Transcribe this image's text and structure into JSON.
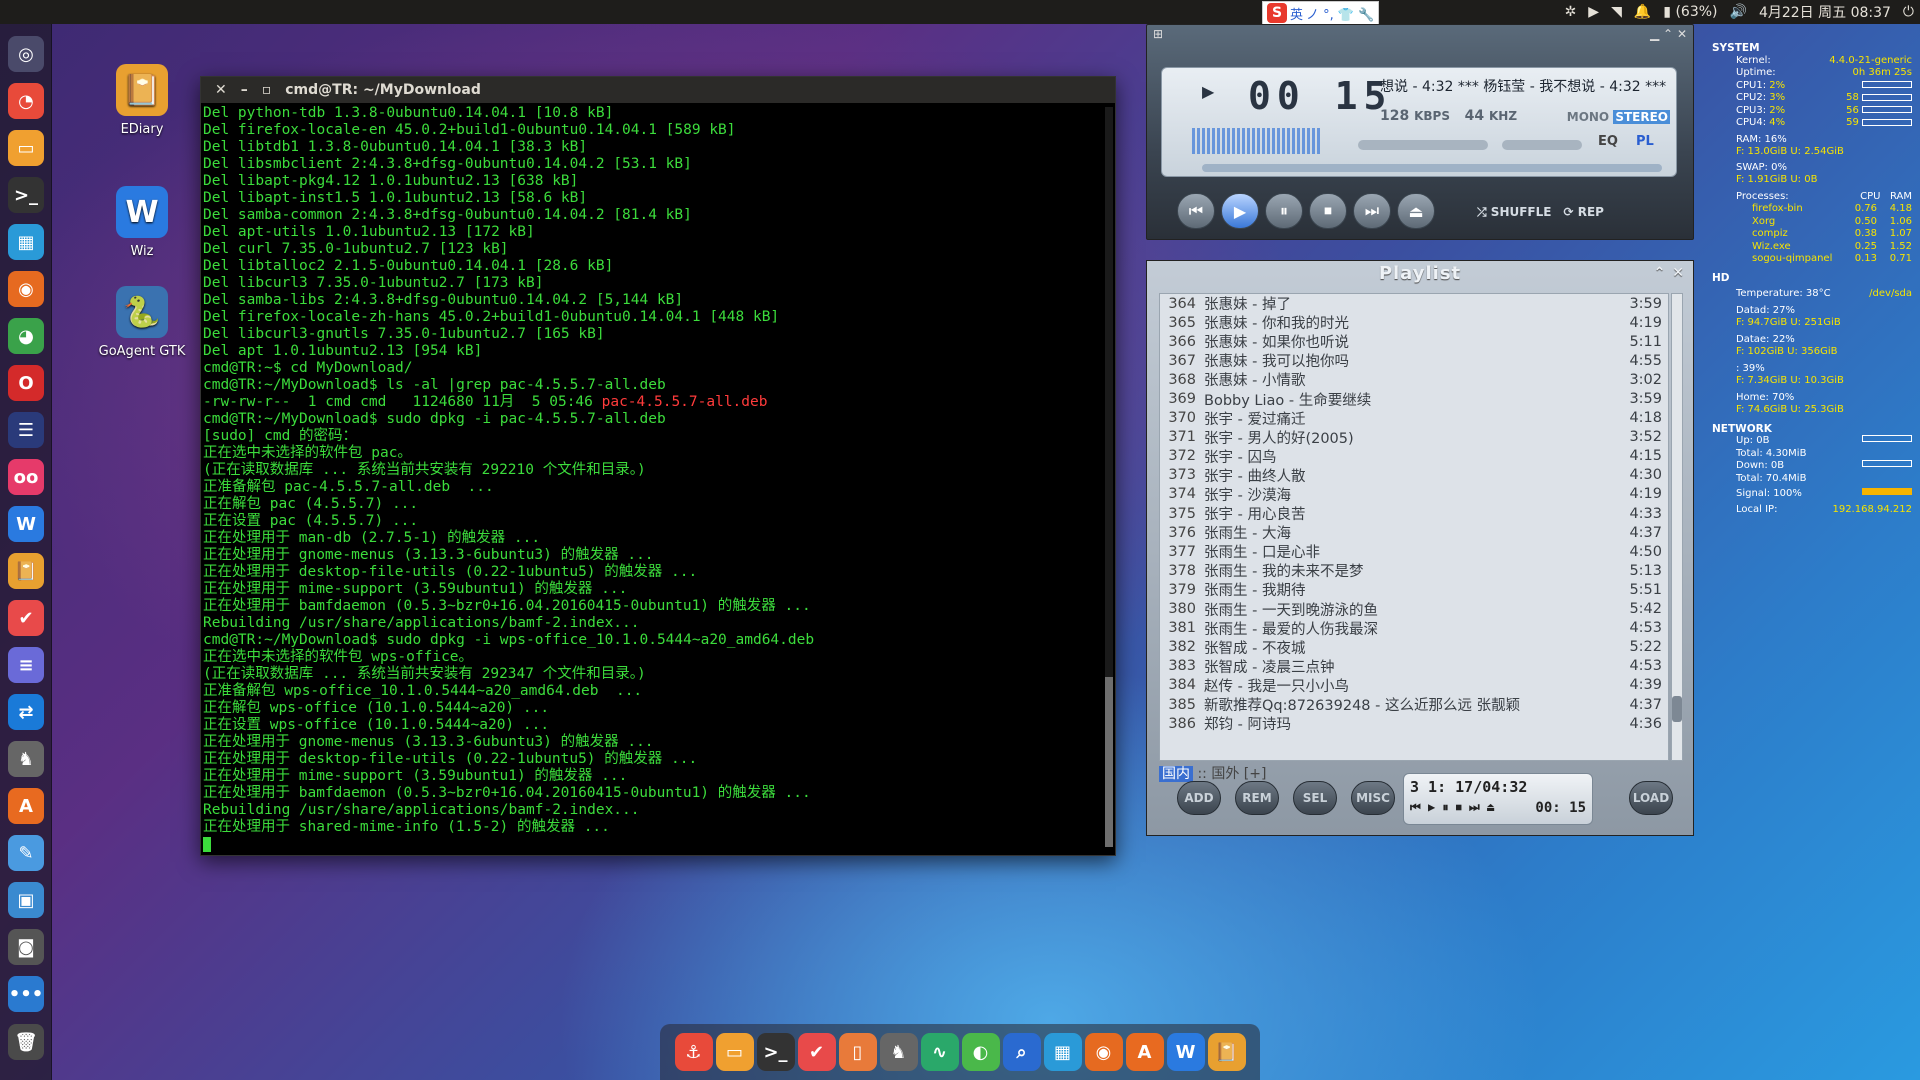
{
  "topbar": {
    "ime_logo": "S",
    "ime_label": "英",
    "ime_extras": "ノ °, 👕 🔧",
    "battery": "(63%)",
    "datetime": "4月22日 周五 08:37"
  },
  "desktop_icons": [
    {
      "label": "EDiary",
      "icon": "book-icon",
      "color": "#e8a030",
      "glyph": "📔"
    },
    {
      "label": "Wiz",
      "icon": "wiz-icon",
      "color": "#2a7ae0",
      "glyph": "W"
    },
    {
      "label": "GoAgent GTK",
      "icon": "python-icon",
      "color": "#3a72b0",
      "glyph": "🐍"
    }
  ],
  "launcher": [
    {
      "name": "ubuntu-icon",
      "color": "#4a4a6a",
      "glyph": "◎"
    },
    {
      "name": "chart-icon",
      "color": "#e84a3a",
      "glyph": "◔"
    },
    {
      "name": "files-icon",
      "color": "#f0a030",
      "glyph": "▭"
    },
    {
      "name": "terminal-icon",
      "color": "#333",
      "glyph": ">_"
    },
    {
      "name": "monitor-icon",
      "color": "#2a9ad8",
      "glyph": "▦"
    },
    {
      "name": "firefox-icon",
      "color": "#e66a20",
      "glyph": "◉"
    },
    {
      "name": "chrome-icon",
      "color": "#3aa24a",
      "glyph": "◕"
    },
    {
      "name": "opera-icon",
      "color": "#d42a2a",
      "glyph": "O"
    },
    {
      "name": "eclipse-icon",
      "color": "#2a3a7a",
      "glyph": "☰"
    },
    {
      "name": "flickr-icon",
      "color": "#e63a6a",
      "glyph": "oo"
    },
    {
      "name": "wiz-icon",
      "color": "#2a7ae0",
      "glyph": "W"
    },
    {
      "name": "ediary-icon",
      "color": "#e8a030",
      "glyph": "📔"
    },
    {
      "name": "todo-icon",
      "color": "#e84a4a",
      "glyph": "✔"
    },
    {
      "name": "document-icon",
      "color": "#6a6ad8",
      "glyph": "≡"
    },
    {
      "name": "teamviewer-icon",
      "color": "#1a7ad8",
      "glyph": "⇄"
    },
    {
      "name": "bird-icon",
      "color": "#666",
      "glyph": "♞"
    },
    {
      "name": "software-center-icon",
      "color": "#e86a20",
      "glyph": "A"
    },
    {
      "name": "notes-icon",
      "color": "#4a9ae0",
      "glyph": "✎"
    },
    {
      "name": "package-icon",
      "color": "#3a8ad0",
      "glyph": "▣"
    },
    {
      "name": "camera-icon",
      "color": "#555",
      "glyph": "◙"
    },
    {
      "name": "more-icon",
      "color": "#2a7ad0",
      "glyph": "•••"
    },
    {
      "name": "trash-icon",
      "color": "#4a4a4a",
      "glyph": "🗑"
    }
  ],
  "terminal": {
    "title": "cmd@TR: ~/MyDownload",
    "lines": [
      "Del python-tdb 1.3.8-0ubuntu0.14.04.1 [10.8 kB]",
      "Del firefox-locale-en 45.0.2+build1-0ubuntu0.14.04.1 [589 kB]",
      "Del libtdb1 1.3.8-0ubuntu0.14.04.1 [38.3 kB]",
      "Del libsmbclient 2:4.3.8+dfsg-0ubuntu0.14.04.2 [53.1 kB]",
      "Del libapt-pkg4.12 1.0.1ubuntu2.13 [638 kB]",
      "Del libapt-inst1.5 1.0.1ubuntu2.13 [58.6 kB]",
      "Del samba-common 2:4.3.8+dfsg-0ubuntu0.14.04.2 [81.4 kB]",
      "Del apt-utils 1.0.1ubuntu2.13 [172 kB]",
      "Del curl 7.35.0-1ubuntu2.7 [123 kB]",
      "Del libtalloc2 2.1.5-0ubuntu0.14.04.1 [28.6 kB]",
      "Del libcurl3 7.35.0-1ubuntu2.7 [173 kB]",
      "Del samba-libs 2:4.3.8+dfsg-0ubuntu0.14.04.2 [5,144 kB]",
      "Del firefox-locale-zh-hans 45.0.2+build1-0ubuntu0.14.04.1 [448 kB]",
      "Del libcurl3-gnutls 7.35.0-1ubuntu2.7 [165 kB]",
      "Del apt 1.0.1ubuntu2.13 [954 kB]",
      "cmd@TR:~$ cd MyDownload/",
      "cmd@TR:~/MyDownload$ ls -al |grep pac-4.5.5.7-all.deb",
      "-rw-rw-r--  1 cmd cmd   1124680 11月  5 05:46 ",
      "cmd@TR:~/MyDownload$ sudo dpkg -i pac-4.5.5.7-all.deb",
      "[sudo] cmd 的密码：",
      "正在选中未选择的软件包 pac。",
      "(正在读取数据库 ... 系统当前共安装有 292210 个文件和目录。)",
      "正准备解包 pac-4.5.5.7-all.deb  ...",
      "正在解包 pac (4.5.5.7) ...",
      "正在设置 pac (4.5.5.7) ...",
      "正在处理用于 man-db (2.7.5-1) 的触发器 ...",
      "正在处理用于 gnome-menus (3.13.3-6ubuntu3) 的触发器 ...",
      "正在处理用于 desktop-file-utils (0.22-1ubuntu5) 的触发器 ...",
      "正在处理用于 mime-support (3.59ubuntu1) 的触发器 ...",
      "正在处理用于 bamfdaemon (0.5.3~bzr0+16.04.20160415-0ubuntu1) 的触发器 ...",
      "Rebuilding /usr/share/applications/bamf-2.index...",
      "cmd@TR:~/MyDownload$ sudo dpkg -i wps-office_10.1.0.5444~a20_amd64.deb",
      "正在选中未选择的软件包 wps-office。",
      "(正在读取数据库 ... 系统当前共安装有 292347 个文件和目录。)",
      "正准备解包 wps-office_10.1.0.5444~a20_amd64.deb  ...",
      "正在解包 wps-office (10.1.0.5444~a20) ...",
      "正在设置 wps-office (10.1.0.5444~a20) ...",
      "正在处理用于 gnome-menus (3.13.3-6ubuntu3) 的触发器 ...",
      "正在处理用于 desktop-file-utils (0.22-1ubuntu5) 的触发器 ...",
      "正在处理用于 mime-support (3.59ubuntu1) 的触发器 ...",
      "正在处理用于 bamfdaemon (0.5.3~bzr0+16.04.20160415-0ubuntu1) 的触发器 ...",
      "Rebuilding /usr/share/applications/bamf-2.index...",
      "正在处理用于 shared-mime-info (1.5-2) 的触发器 ..."
    ],
    "highlight_line": 17,
    "highlight_text": "pac-4.5.5.7-all.deb"
  },
  "player": {
    "time": "00 15",
    "title": "想说 - 4:32  *** 杨钰莹 - 我不想说 - 4:32  ***",
    "kbps": "128",
    "kbps_unit": "KBPS",
    "khz": "44",
    "khz_unit": "KHZ",
    "mono": "MONO",
    "stereo": "STEREO",
    "eq": "EQ",
    "pl": "PL",
    "shuffle": "SHUFFLE",
    "rep": "REP"
  },
  "playlist": {
    "title": "Playlist",
    "items": [
      {
        "n": "364",
        "t": "张惠妹 - 掉了",
        "d": "3:59"
      },
      {
        "n": "365",
        "t": "张惠妹 - 你和我的时光",
        "d": "4:19"
      },
      {
        "n": "366",
        "t": "张惠妹 - 如果你也听说",
        "d": "5:11"
      },
      {
        "n": "367",
        "t": "张惠妹 - 我可以抱你吗",
        "d": "4:55"
      },
      {
        "n": "368",
        "t": "张惠妹 - 小情歌",
        "d": "3:02"
      },
      {
        "n": "369",
        "t": "Bobby Liao - 生命要继续",
        "d": "3:59"
      },
      {
        "n": "370",
        "t": "张宇 - 爱过痛迁",
        "d": "4:18"
      },
      {
        "n": "371",
        "t": "张宇 - 男人的好(2005)",
        "d": "3:52"
      },
      {
        "n": "372",
        "t": "张宇 - 囚鸟",
        "d": "4:15"
      },
      {
        "n": "373",
        "t": "张宇 - 曲终人散",
        "d": "4:30"
      },
      {
        "n": "374",
        "t": "张宇 - 沙漠海",
        "d": "4:19"
      },
      {
        "n": "375",
        "t": "张宇 - 用心良苦",
        "d": "4:33"
      },
      {
        "n": "376",
        "t": "张雨生 - 大海",
        "d": "4:37"
      },
      {
        "n": "377",
        "t": "张雨生 - 口是心非",
        "d": "4:50"
      },
      {
        "n": "378",
        "t": "张雨生 - 我的未来不是梦",
        "d": "5:13"
      },
      {
        "n": "379",
        "t": "张雨生 - 我期待",
        "d": "5:51"
      },
      {
        "n": "380",
        "t": "张雨生 - 一天到晚游泳的鱼",
        "d": "5:42"
      },
      {
        "n": "381",
        "t": "张雨生 - 最爱的人伤我最深",
        "d": "4:53"
      },
      {
        "n": "382",
        "t": "张智成 - 不夜城",
        "d": "5:22"
      },
      {
        "n": "383",
        "t": "张智成 - 凌晨三点钟",
        "d": "4:53"
      },
      {
        "n": "384",
        "t": "赵传 - 我是一只小小鸟",
        "d": "4:39"
      },
      {
        "n": "385",
        "t": "新歌推荐Qq:872639248 - 这么近那么远 张靓颖",
        "d": "4:37"
      },
      {
        "n": "386",
        "t": "郑钧 - 阿诗玛",
        "d": "4:36"
      }
    ],
    "tab_active": "国内",
    "tab_rest": ":: 国外  [+]",
    "buttons": [
      "ADD",
      "REM",
      "SEL",
      "MISC"
    ],
    "load": "LOAD",
    "pos": "3 1: 17/04:32",
    "elapsed": "00: 15"
  },
  "conky": {
    "system_title": "SYSTEM",
    "kernel_label": "Kernel:",
    "kernel": "4.4.0-21-generic",
    "uptime_label": "Uptime:",
    "uptime": "0h 36m 25s",
    "cpus": [
      {
        "label": "CPU1:",
        "pct": "2%",
        "v": ""
      },
      {
        "label": "CPU2:",
        "pct": "3%",
        "v": "58"
      },
      {
        "label": "CPU3:",
        "pct": "2%",
        "v": "56"
      },
      {
        "label": "CPU4:",
        "pct": "4%",
        "v": "59"
      }
    ],
    "ram": "RAM: 16%",
    "ram_detail": "F: 13.0GiB U: 2.54GiB",
    "swap": "SWAP: 0%",
    "swap_detail": "F: 1.91GiB U: 0B",
    "proc_label": "Processes:",
    "proc_cpu": "CPU",
    "proc_ram": "RAM",
    "procs": [
      {
        "n": "firefox-bin",
        "c": "0.76",
        "r": "4.18"
      },
      {
        "n": "Xorg",
        "c": "0.50",
        "r": "1.06"
      },
      {
        "n": "compiz",
        "c": "0.38",
        "r": "1.07"
      },
      {
        "n": "Wiz.exe",
        "c": "0.25",
        "r": "1.52"
      },
      {
        "n": "sogou-qimpanel",
        "c": "0.13",
        "r": "0.71"
      }
    ],
    "hd_title": "HD",
    "temp": "Temperature: 38°C",
    "temp_dev": "/dev/sda",
    "disks": [
      {
        "a": "Datad: 27%",
        "b": "F: 94.7GiB U: 251GiB"
      },
      {
        "a": "Datae: 22%",
        "b": "F: 102GiB U: 356GiB"
      },
      {
        "a": ": 39%",
        "b": "F: 7.34GiB U: 10.3GiB"
      },
      {
        "a": "Home: 70%",
        "b": "F: 74.6GiB U: 25.3GiB"
      }
    ],
    "net_title": "NETWORK",
    "up": "Up: 0B",
    "up_total": "Total: 4.30MiB",
    "down": "Down: 0B",
    "down_total": "Total: 70.4MiB",
    "signal": "Signal: 100%",
    "ip_label": "Local IP:",
    "ip": "192.168.94.212"
  },
  "dock": [
    {
      "name": "anchor-icon",
      "color": "#e84a3a",
      "glyph": "⚓"
    },
    {
      "name": "files-icon",
      "color": "#f0a030",
      "glyph": "▭"
    },
    {
      "name": "terminal-icon",
      "color": "#333",
      "glyph": ">_"
    },
    {
      "name": "todo-icon",
      "color": "#e84a4a",
      "glyph": "✔"
    },
    {
      "name": "phone-icon",
      "color": "#e87a3a",
      "glyph": "▯"
    },
    {
      "name": "bird-icon",
      "color": "#666",
      "glyph": "♞"
    },
    {
      "name": "activity-icon",
      "color": "#2aa86a",
      "glyph": "∿"
    },
    {
      "name": "toggle-icon",
      "color": "#4ab84a",
      "glyph": "◐"
    },
    {
      "name": "search-doc-icon",
      "color": "#2a6ad0",
      "glyph": "⌕"
    },
    {
      "name": "monitor-icon",
      "color": "#2a9ad8",
      "glyph": "▦"
    },
    {
      "name": "firefox-icon",
      "color": "#e66a20",
      "glyph": "◉"
    },
    {
      "name": "software-center-icon",
      "color": "#e86a20",
      "glyph": "A"
    },
    {
      "name": "wiz-icon",
      "color": "#2a7ae0",
      "glyph": "W"
    },
    {
      "name": "ediary-icon",
      "color": "#e8a030",
      "glyph": "📔"
    }
  ]
}
